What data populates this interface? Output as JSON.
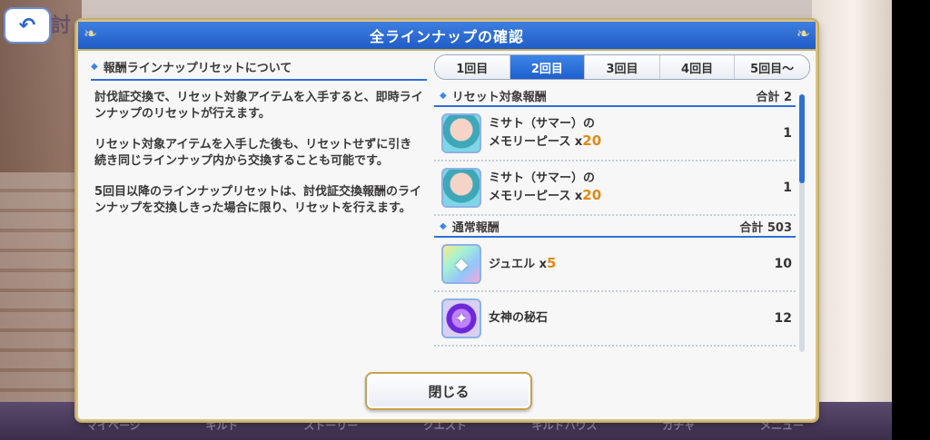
{
  "dialog": {
    "title": "全ラインナップの確認",
    "section_title": "報酬ラインナップリセットについて",
    "paragraphs": [
      "討伐証交換で、リセット対象アイテムを入手すると、即時ラインナップのリセットが行えます。",
      "リセット対象アイテムを入手した後も、リセットせずに引き続き同じラインナップ内から交換することも可能です。",
      "5回目以降のラインナップリセットは、討伐証交換報酬のラインナップを交換しきった場合に限り、リセットを行えます。"
    ],
    "close_label": "閉じる"
  },
  "tabs": [
    {
      "label": "1回目",
      "active": false
    },
    {
      "label": "2回目",
      "active": true
    },
    {
      "label": "3回目",
      "active": false
    },
    {
      "label": "4回目",
      "active": false
    },
    {
      "label": "5回目～",
      "active": false
    }
  ],
  "groups": {
    "reset": {
      "title": "リセット対象報酬",
      "total": "合計 2",
      "items": [
        {
          "name_line1": "ミサト（サマー）の",
          "name_line2": "メモリーピース x",
          "qty": "20",
          "count": "1",
          "icon": "memory-piece-icon"
        },
        {
          "name_line1": "ミサト（サマー）の",
          "name_line2": "メモリーピース x",
          "qty": "20",
          "count": "1",
          "icon": "memory-piece-icon"
        }
      ]
    },
    "normal": {
      "title": "通常報酬",
      "total": "合計 503",
      "items": [
        {
          "name": "ジュエル x",
          "qty": "5",
          "count": "10",
          "icon": "jewel-icon"
        },
        {
          "name": "女神の秘石",
          "qty": "",
          "count": "12",
          "icon": "goddess-stone-icon"
        }
      ]
    }
  },
  "background": {
    "title_fragment": "討",
    "nav": [
      "マイページ",
      "ギルド",
      "ストーリー",
      "クエスト",
      "ギルドハウス",
      "ガチャ",
      "メニュー"
    ]
  },
  "colors": {
    "accent_blue": "#1f5cc7",
    "gold_border": "#c7ae68",
    "quantity_orange": "#e08a12"
  }
}
